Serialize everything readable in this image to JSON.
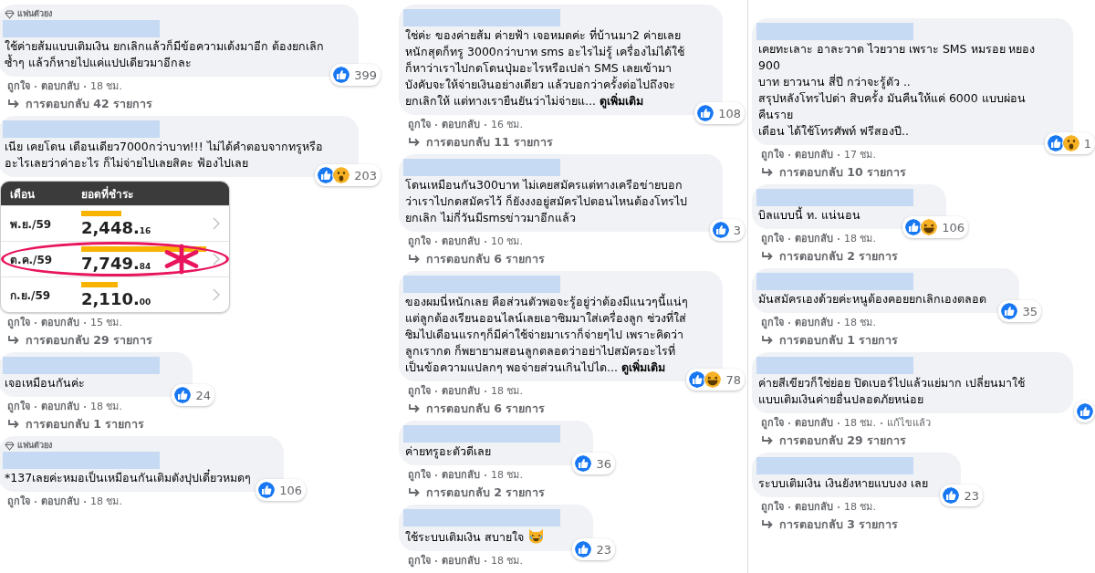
{
  "columns": [
    {
      "comments": [
        {
          "badge": "แฟนตัวยง",
          "text": "ใช้ค่ายส้มแบบเติมเงิน ยกเลิกแล้วก็มีข้อความเด้งมาอีก ต้องยกเลิกซ้ำๆ แล้วก็หายไปแค่แปปเดียวมาอีกละ",
          "reactions": [
            {
              "kind": "like"
            }
          ],
          "reaction_count": "399",
          "meta": [
            {
              "text": "ถูกใจ",
              "kind": "link"
            },
            {
              "text": "ตอบกลับ",
              "kind": "link"
            },
            {
              "text": "18 ชม.",
              "kind": "info"
            }
          ],
          "replies": "การตอบกลับ 42 รายการ"
        },
        {
          "text": "เนีย เคยโดน เดือนเดียว7000กว่าบาท!!! ไม่ได้คำตอบจากทรูหรืออะไรเลยว่าค่าอะไร ก็ไม่จ่ายไปเลยสิคะ ฟ้องไปเลย",
          "bill": {
            "headers": [
              "เดือน",
              "ยอดที่ชำระ"
            ],
            "rows": [
              {
                "month": "พ.ย./59",
                "amount": "2,448.",
                "cents": "16",
                "highlighted": false
              },
              {
                "month": "ต.ค./59",
                "amount": "7,749.",
                "cents": "84",
                "highlighted": true
              },
              {
                "month": "ก.ย./59",
                "amount": "2,110.",
                "cents": "00",
                "highlighted": false
              }
            ]
          },
          "reactions": [
            {
              "kind": "like"
            },
            {
              "kind": "wow"
            }
          ],
          "reaction_count": "203",
          "meta": [
            {
              "text": "ถูกใจ",
              "kind": "link"
            },
            {
              "text": "ตอบกลับ",
              "kind": "link"
            },
            {
              "text": "15 ชม.",
              "kind": "info"
            }
          ],
          "replies": "การตอบกลับ 29 รายการ"
        },
        {
          "text": "เจอเหมือนกันค่ะ",
          "reactions": [
            {
              "kind": "like"
            }
          ],
          "reaction_count": "24",
          "meta": [
            {
              "text": "ถูกใจ",
              "kind": "link"
            },
            {
              "text": "ตอบกลับ",
              "kind": "link"
            },
            {
              "text": "18 ชม.",
              "kind": "info"
            }
          ],
          "replies": "การตอบกลับ 1 รายการ"
        },
        {
          "badge": "แฟนตัวยง",
          "text": "*137เลยค่ะหมอเป็นเหมือนกันเติมตังปุปเดี๋ยวหมดๆ",
          "reactions": [
            {
              "kind": "like"
            }
          ],
          "reaction_count": "106",
          "meta": [
            {
              "text": "ถูกใจ",
              "kind": "link"
            },
            {
              "text": "ตอบกลับ",
              "kind": "link"
            },
            {
              "text": "18 ชม.",
              "kind": "info"
            }
          ]
        }
      ]
    },
    {
      "comments": [
        {
          "text": "ใช่ค่ะ ของค่ายส้ม ค่ายฟ้า เจอหมดค่ะ ที่บ้านมา2 ค่ายเลย หนักสุดก็ทรู 3000กว่าบาท sms อะไรไม่รู้ เครื่องไม่ได้ใช้ ก็หาว่าเราไปกดโดนปุ่มอะไรหรือเปล่า SMS เลยเข้ามา บังคับจะให้จ่ายเงินอย่างเดียว แล้วบอกว่าครั้งต่อไปถึงจะยกเลิกให้ แต่ทางเรายืนยันว่าไม่จ่ายแ...",
          "see_more": "ดูเพิ่มเติม",
          "reactions": [
            {
              "kind": "like"
            }
          ],
          "reaction_count": "108",
          "meta": [
            {
              "text": "ถูกใจ",
              "kind": "link"
            },
            {
              "text": "ตอบกลับ",
              "kind": "link"
            },
            {
              "text": "16 ชม.",
              "kind": "info"
            }
          ],
          "replies": "การตอบกลับ 11 รายการ"
        },
        {
          "text": "โดนเหมือนกัน300บาท ไม่เคยสมัครแต่ทางเครือข่ายบอกว่าเราไปกดสมัครไว้ ก็ยังงงอยู่สมัครไปตอนไหนต้องโทรไปยกเลิก ไม่กี่วันมีsmsข่าวมาอีกแล้ว",
          "reactions": [
            {
              "kind": "like"
            }
          ],
          "reaction_count": "3",
          "meta": [
            {
              "text": "ถูกใจ",
              "kind": "link"
            },
            {
              "text": "ตอบกลับ",
              "kind": "link"
            },
            {
              "text": "10 ชม.",
              "kind": "info"
            }
          ],
          "replies": "การตอบกลับ 6 รายการ"
        },
        {
          "text": "ของผมนี่หนักเลย คือส่วนตัวพอจะรู้อยู่ว่าต้องมีแนวๆนี้แน่ๆ แต่ลูกต้องเรียนออนไลน์เลยเอาซิมมาใส่เครื่องลูก ช่วงที่ใส่ซิมไปเดือนแรกๆก็มีค่าใช้จ่ายมาเราก็จ่ายๆไป เพราะคิดว่าลูกเรากด ก็พยายามสอนลูกตลอดว่าอย่าไปสมัครอะไรที่เป็นข้อความแปลกๆ พอจ่ายส่วนเกินไปได...",
          "see_more": "ดูเพิ่มเติม",
          "reactions": [
            {
              "kind": "like"
            },
            {
              "kind": "haha"
            }
          ],
          "reaction_count": "78",
          "meta": [
            {
              "text": "ถูกใจ",
              "kind": "link"
            },
            {
              "text": "ตอบกลับ",
              "kind": "link"
            },
            {
              "text": "18 ชม.",
              "kind": "info"
            }
          ],
          "replies": "การตอบกลับ 6 รายการ"
        },
        {
          "text": "ค่ายทรูอะตัวดีเลย",
          "reactions": [
            {
              "kind": "like"
            }
          ],
          "reaction_count": "36",
          "meta": [
            {
              "text": "ถูกใจ",
              "kind": "link"
            },
            {
              "text": "ตอบกลับ",
              "kind": "link"
            },
            {
              "text": "18 ชม.",
              "kind": "info"
            }
          ],
          "replies": "การตอบกลับ 2 รายการ"
        },
        {
          "text": "ใช้ระบบเติมเงิน สบายใจ",
          "text_icon": {
            "kind": "laughing"
          },
          "reactions": [
            {
              "kind": "like"
            }
          ],
          "reaction_count": "23",
          "meta": [
            {
              "text": "ถูกใจ",
              "kind": "link"
            },
            {
              "text": "ตอบกลับ",
              "kind": "link"
            },
            {
              "text": "18 ชม.",
              "kind": "info"
            }
          ]
        }
      ]
    },
    {
      "comments": [
        {
          "text": "เคยทะเลาะ อาละวาด ไวยวาย เพราะ SMS หมรอย หยอง 900\nบาท ยาวนาน สี่ปี กว่าจะรู้ตัว ..\nสรุปหลังโทรไปด่า สิบครั้ง มันคืนให้แค่ 6000 แบบผ่อนคืนราย\nเดือน ได้ใช้โทรศัพท์ ฟรีสองปี..",
          "reactions": [
            {
              "kind": "like"
            },
            {
              "kind": "wow"
            }
          ],
          "reaction_count": "1",
          "meta": [
            {
              "text": "ถูกใจ",
              "kind": "link"
            },
            {
              "text": "ตอบกลับ",
              "kind": "link"
            },
            {
              "text": "17 ชม.",
              "kind": "info"
            }
          ],
          "replies": "การตอบกลับ 10 รายการ"
        },
        {
          "text": "บิลแบบนี้ ท. แน่นอน",
          "reactions": [
            {
              "kind": "like"
            },
            {
              "kind": "haha"
            }
          ],
          "reaction_count": "106",
          "meta": [
            {
              "text": "ถูกใจ",
              "kind": "link"
            },
            {
              "text": "ตอบกลับ",
              "kind": "link"
            },
            {
              "text": "18 ชม.",
              "kind": "info"
            }
          ],
          "replies": "การตอบกลับ 2 รายการ"
        },
        {
          "text": "มันสมัครเองด้วยค่ะหนูต้องคอยยกเลิกเองตลอด",
          "reactions": [
            {
              "kind": "like"
            }
          ],
          "reaction_count": "35",
          "meta": [
            {
              "text": "ถูกใจ",
              "kind": "link"
            },
            {
              "text": "ตอบกลับ",
              "kind": "link"
            },
            {
              "text": "18 ชม.",
              "kind": "info"
            }
          ],
          "replies": "การตอบกลับ 1 รายการ"
        },
        {
          "text": "ค่ายสีเขียวก็ใช่ย่อย ปิดเบอร์ไปแล้วแย่มาก เปลี่ยนมาใช้แบบเติมเงินค่ายอื่นปลอดภัยหน่อย",
          "reactions": [
            {
              "kind": "like"
            }
          ],
          "meta": [
            {
              "text": "ถูกใจ",
              "kind": "link"
            },
            {
              "text": "ตอบกลับ",
              "kind": "link"
            },
            {
              "text": "18 ชม.",
              "kind": "info"
            },
            {
              "text": "แก้ไขแล้ว",
              "kind": "info"
            }
          ],
          "replies": "การตอบกลับ 29 รายการ"
        },
        {
          "text": "ระบบเติมเงิน เงินยังหายแบบงง เลย",
          "reactions": [
            {
              "kind": "like"
            }
          ],
          "reaction_count": "23",
          "meta": [
            {
              "text": "ถูกใจ",
              "kind": "link"
            },
            {
              "text": "ตอบกลับ",
              "kind": "link"
            },
            {
              "text": "18 ชม.",
              "kind": "info"
            }
          ],
          "replies": "การตอบกลับ 3 รายการ"
        }
      ]
    }
  ]
}
